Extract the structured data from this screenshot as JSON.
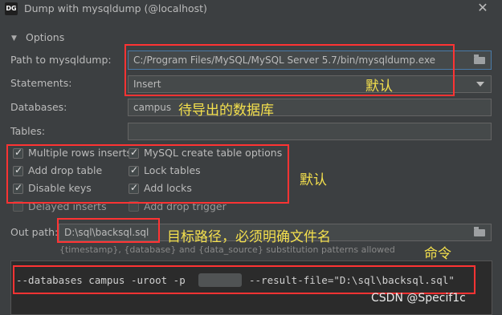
{
  "window": {
    "icon_text": "DG",
    "title": "Dump with mysqldump (@localhost)"
  },
  "options": {
    "section_title": "Options",
    "path_label": "Path to mysqldump:",
    "path_value": "C:/Program Files/MySQL/MySQL Server 5.7/bin/mysqldump.exe",
    "statements_label": "Statements:",
    "statements_value": "Insert",
    "databases_label": "Databases:",
    "databases_value": "campus",
    "tables_label": "Tables:",
    "tables_value": "",
    "checkboxes": [
      {
        "label": "Multiple rows inserts",
        "checked": true
      },
      {
        "label": "MySQL create table options",
        "checked": true
      },
      {
        "label": "Add drop table",
        "checked": true
      },
      {
        "label": "Lock tables",
        "checked": true
      },
      {
        "label": "Disable keys",
        "checked": true
      },
      {
        "label": "Add locks",
        "checked": true
      },
      {
        "label": "Delayed inserts",
        "checked": false
      },
      {
        "label": "Add drop trigger",
        "checked": false
      }
    ],
    "out_path_label": "Out path:",
    "out_path_value": "D:\\sql\\backsql.sql",
    "hint": "{timestamp}, {database} and {data_source} substitution patterns allowed"
  },
  "command": {
    "part1": "--databases campus -uroot -p",
    "part2": "--result-file=\"D:\\sql\\backsql.sql\""
  },
  "annotations": {
    "default_1": "默认",
    "db_to_export": "待导出的数据库",
    "default_2": "默认",
    "target_path": "目标路径，必须明确文件名",
    "command": "命令"
  },
  "watermark": "CSDN @Specif1c",
  "colors": {
    "annotation_box": "#ff3333",
    "annotation_text": "#f4e04d"
  }
}
